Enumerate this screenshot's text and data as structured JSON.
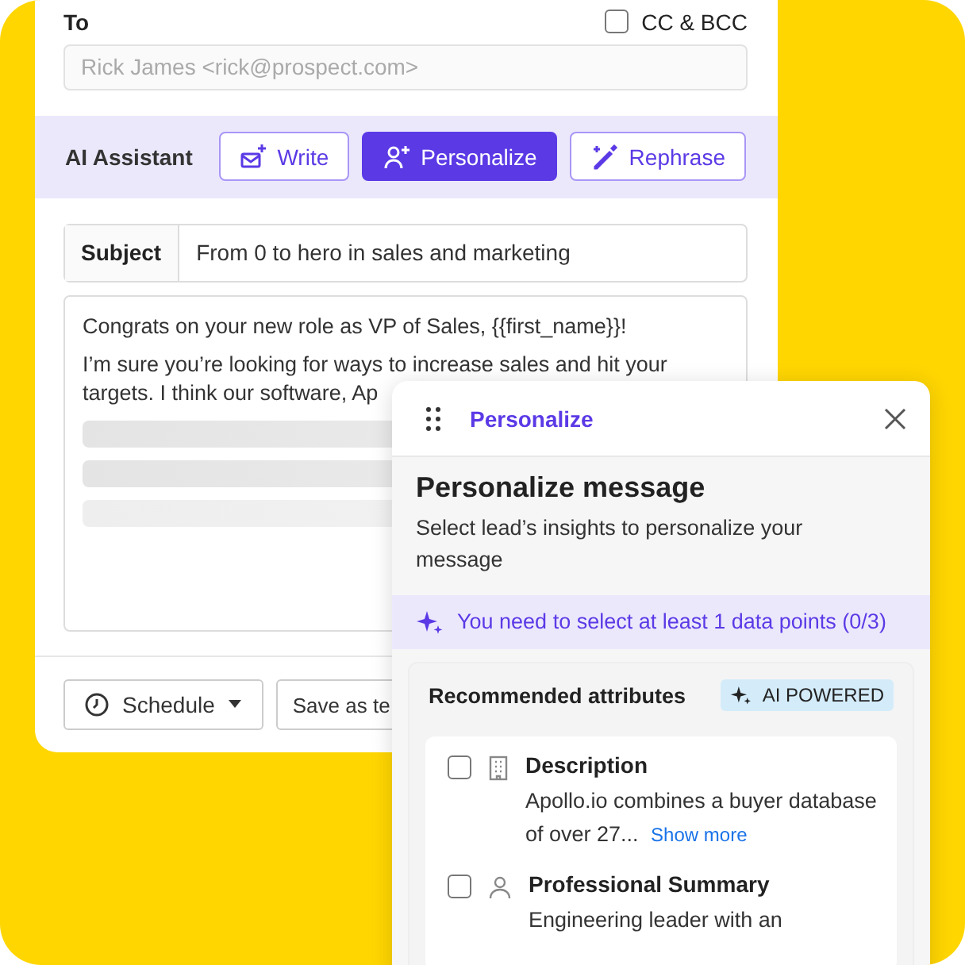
{
  "email": {
    "to_label": "To",
    "cc_bcc": {
      "label": "CC & BCC",
      "checked": false
    },
    "to_field": {
      "placeholder": "Rick James <rick@prospect.com>"
    },
    "ai_assistant": {
      "label": "AI Assistant",
      "buttons": [
        {
          "label": "Write",
          "selected": false
        },
        {
          "label": "Personalize",
          "selected": true
        },
        {
          "label": "Rephrase",
          "selected": false
        }
      ]
    },
    "subject": {
      "label": "Subject",
      "value": "From 0 to hero in sales and marketing"
    },
    "body": {
      "paragraphs": [
        [
          "Congrats on your new role as VP of Sales, {{first_name}}!"
        ],
        [
          "I’m sure you’re looking for ways to increase sales and hit your",
          "targets. I think our software, Ap"
        ]
      ]
    },
    "footer": {
      "schedule": "Schedule",
      "save": "Save as te"
    }
  },
  "panel": {
    "header": "Personalize",
    "title": "Personalize message",
    "subtitle": "Select lead’s insights to personalize your message",
    "notice": "You need to select at least 1 data points (0/3)",
    "attributes": {
      "heading": "Recommended attributes",
      "badge": "AI POWERED",
      "items": [
        {
          "title": "Description",
          "text": "Apollo.io combines a buyer database of over 27...",
          "link": "Show more",
          "checked": false
        },
        {
          "title": "Professional Summary",
          "text": "Engineering leader with an",
          "checked": false
        }
      ]
    }
  }
}
